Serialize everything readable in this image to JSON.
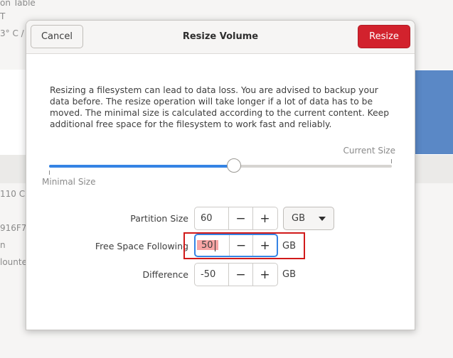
{
  "background": {
    "fragments": [
      "on Table",
      "T",
      "3° C /",
      "110 C",
      "916F7",
      "n",
      "lounte"
    ]
  },
  "dialog": {
    "title": "Resize Volume",
    "cancel_label": "Cancel",
    "resize_label": "Resize",
    "warning": "Resizing a filesystem can lead to data loss. You are advised to backup your data before. The resize operation will take longer if a lot of data has to be moved. The minimal size is calculated according to the current content. Keep additional free space for the filesystem to work fast and reliably.",
    "current_size_label": "Current Size",
    "minimal_size_label": "Minimal Size",
    "slider_fraction": 0.54,
    "partition_size": {
      "label": "Partition Size",
      "value": "60",
      "unit": "GB"
    },
    "free_space_following": {
      "label": "Free Space Following",
      "value": "50",
      "unit": "GB"
    },
    "difference": {
      "label": "Difference",
      "value": "-50",
      "unit": "GB"
    },
    "minus_symbol": "−",
    "plus_symbol": "+"
  },
  "colors": {
    "accent": "#3584e4",
    "destructive": "#d2222d",
    "annotation": "#d11a1a"
  }
}
